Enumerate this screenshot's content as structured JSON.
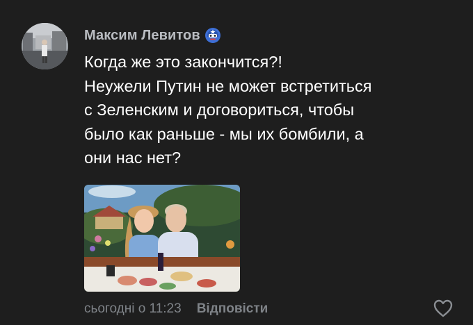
{
  "comment": {
    "author": "Максим Левитов",
    "badge_icon": "captain-shield-badge-icon",
    "message_lines": [
      "Когда же это закончится?!",
      "Неужели Путин не может встретиться",
      "с Зеленским и договориться, чтобы",
      "было как раньше - мы их бомбили, а",
      "они нас нет?"
    ],
    "attachment": "image",
    "timestamp": "сьогодні о 11:23",
    "reply_label": "Відповісти",
    "like_icon": "heart-outline-icon"
  },
  "colors": {
    "background": "#1e1e1e",
    "author": "#b9bcc1",
    "text": "#ffffff",
    "meta": "#7f8388"
  }
}
